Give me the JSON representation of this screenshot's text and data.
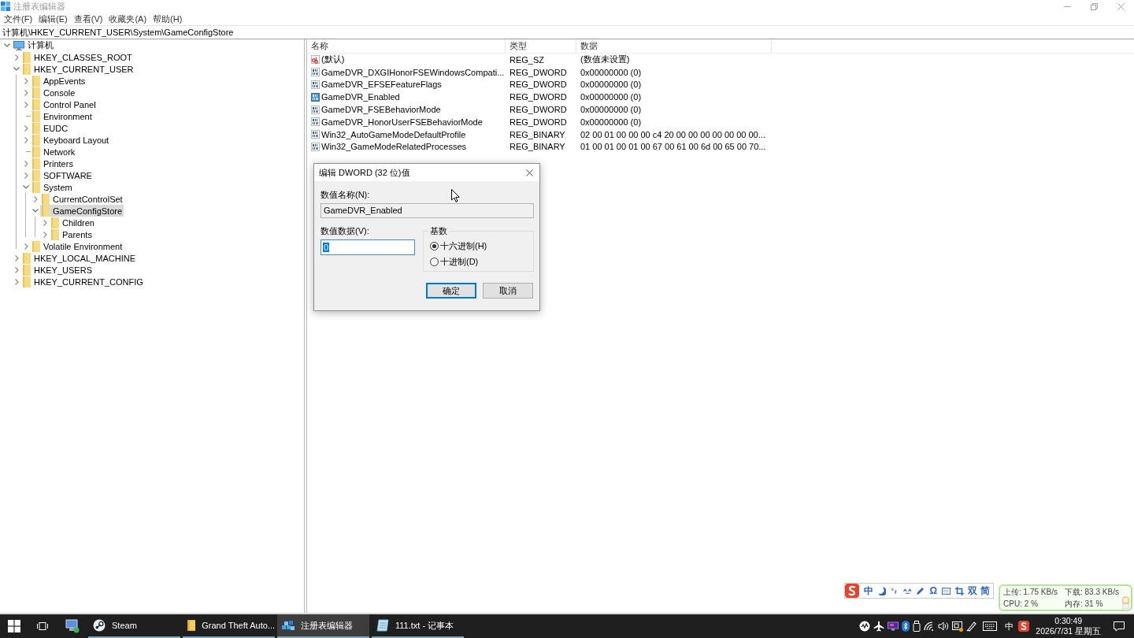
{
  "window": {
    "title": "注册表编辑器"
  },
  "menu": [
    "文件(F)",
    "编辑(E)",
    "查看(V)",
    "收藏夹(A)",
    "帮助(H)"
  ],
  "address": "计算机\\HKEY_CURRENT_USER\\System\\GameConfigStore",
  "tree": [
    {
      "label": "计算机",
      "kind": "computer",
      "expandable": true,
      "expanded": true,
      "selected": false,
      "children": [
        {
          "label": "HKEY_CLASSES_ROOT",
          "kind": "folder",
          "expandable": true,
          "expanded": false,
          "selected": false
        },
        {
          "label": "HKEY_CURRENT_USER",
          "kind": "folder",
          "expandable": true,
          "expanded": true,
          "selected": false,
          "children": [
            {
              "label": "AppEvents",
              "kind": "folder",
              "expandable": true,
              "expanded": false,
              "selected": false
            },
            {
              "label": "Console",
              "kind": "folder",
              "expandable": true,
              "expanded": false,
              "selected": false
            },
            {
              "label": "Control Panel",
              "kind": "folder",
              "expandable": true,
              "expanded": false,
              "selected": false
            },
            {
              "label": "Environment",
              "kind": "folder",
              "expandable": false,
              "selected": false
            },
            {
              "label": "EUDC",
              "kind": "folder",
              "expandable": true,
              "expanded": false,
              "selected": false
            },
            {
              "label": "Keyboard Layout",
              "kind": "folder",
              "expandable": true,
              "expanded": false,
              "selected": false
            },
            {
              "label": "Network",
              "kind": "folder",
              "expandable": false,
              "selected": false
            },
            {
              "label": "Printers",
              "kind": "folder",
              "expandable": true,
              "expanded": false,
              "selected": false
            },
            {
              "label": "SOFTWARE",
              "kind": "folder",
              "expandable": true,
              "expanded": false,
              "selected": false
            },
            {
              "label": "System",
              "kind": "folder",
              "expandable": true,
              "expanded": true,
              "selected": false,
              "children": [
                {
                  "label": "CurrentControlSet",
                  "kind": "folder",
                  "expandable": true,
                  "expanded": false,
                  "selected": false
                },
                {
                  "label": "GameConfigStore",
                  "kind": "folder",
                  "expandable": true,
                  "expanded": true,
                  "selected": true,
                  "children": [
                    {
                      "label": "Children",
                      "kind": "folder",
                      "expandable": true,
                      "expanded": false,
                      "selected": false
                    },
                    {
                      "label": "Parents",
                      "kind": "folder",
                      "expandable": true,
                      "expanded": false,
                      "selected": false
                    }
                  ]
                }
              ]
            },
            {
              "label": "Volatile Environment",
              "kind": "folder",
              "expandable": true,
              "expanded": false,
              "selected": false
            }
          ]
        },
        {
          "label": "HKEY_LOCAL_MACHINE",
          "kind": "folder",
          "expandable": true,
          "expanded": false,
          "selected": false
        },
        {
          "label": "HKEY_USERS",
          "kind": "folder",
          "expandable": true,
          "expanded": false,
          "selected": false
        },
        {
          "label": "HKEY_CURRENT_CONFIG",
          "kind": "folder",
          "expandable": true,
          "expanded": false,
          "selected": false
        }
      ]
    }
  ],
  "list": {
    "columns": [
      "名称",
      "类型",
      "数据"
    ],
    "rows": [
      {
        "kind": "string",
        "name": "(默认)",
        "type": "REG_SZ",
        "data": "(数值未设置)",
        "selected": false
      },
      {
        "kind": "binary",
        "name": "GameDVR_DXGIHonorFSEWindowsCompati...",
        "type": "REG_DWORD",
        "data": "0x00000000 (0)",
        "selected": false
      },
      {
        "kind": "binary",
        "name": "GameDVR_EFSEFeatureFlags",
        "type": "REG_DWORD",
        "data": "0x00000000 (0)",
        "selected": false
      },
      {
        "kind": "binary",
        "name": "GameDVR_Enabled",
        "type": "REG_DWORD",
        "data": "0x00000000 (0)",
        "selected": true
      },
      {
        "kind": "binary",
        "name": "GameDVR_FSEBehaviorMode",
        "type": "REG_DWORD",
        "data": "0x00000000 (0)",
        "selected": false
      },
      {
        "kind": "binary",
        "name": "GameDVR_HonorUserFSEBehaviorMode",
        "type": "REG_DWORD",
        "data": "0x00000000 (0)",
        "selected": false
      },
      {
        "kind": "binary",
        "name": "Win32_AutoGameModeDefaultProfile",
        "type": "REG_BINARY",
        "data": "02 00 01 00 00 00 c4 20 00 00 00 00 00 00 00...",
        "selected": false
      },
      {
        "kind": "binary",
        "name": "Win32_GameModeRelatedProcesses",
        "type": "REG_BINARY",
        "data": "01 00 01 00 01 00 67 00 61 00 6d 00 65 00 70...",
        "selected": false
      }
    ]
  },
  "dialog": {
    "title": "编辑 DWORD (32 位)值",
    "name_label": "数值名称(N):",
    "name_value": "GameDVR_Enabled",
    "data_label": "数值数据(V):",
    "data_value": "0",
    "data_text_selected": true,
    "base_label": "基数",
    "bases": [
      {
        "label": "十六进制(H)",
        "selected": true
      },
      {
        "label": "十进制(D)",
        "selected": false
      }
    ],
    "buttons": [
      {
        "label": "确定",
        "default": true
      },
      {
        "label": "取消",
        "default": false
      }
    ]
  },
  "ime_toolbar": {
    "mode": "中",
    "symbol": "Ω",
    "layout": "双",
    "charset": "简"
  },
  "net_monitor": {
    "upload": "上传: 1.75 KB/s",
    "download": "下载: 83.3 KB/s",
    "cpu": "CPU: 2 %",
    "memory": "内存: 31 %"
  },
  "taskbar": {
    "apps": [
      {
        "kind": "steam",
        "label": "Steam",
        "selected": false
      },
      {
        "kind": "folder",
        "label": "Grand Theft Auto...",
        "selected": false
      },
      {
        "kind": "regedit",
        "label": "注册表编辑器",
        "selected": true
      },
      {
        "kind": "notepad",
        "label": "111.txt - 记事本",
        "selected": false
      }
    ],
    "input_mode": "中",
    "time": "0:30:49",
    "date": "2026/7/31 星期五"
  }
}
